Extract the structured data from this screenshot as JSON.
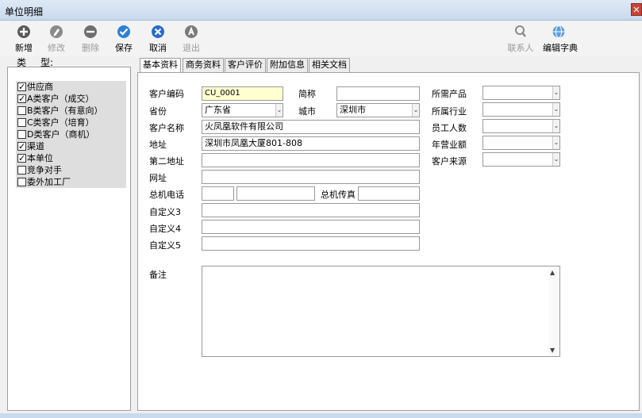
{
  "window": {
    "title": "单位明细",
    "close_glyph": "✕"
  },
  "toolbar": {
    "new": "新增",
    "edit": "修改",
    "delete": "删除",
    "save": "保存",
    "cancel": "取消",
    "exit": "退出",
    "contacts": "联系人",
    "edit_dict": "编辑字典"
  },
  "left": {
    "header_a": "类",
    "header_b": "型:",
    "items": [
      {
        "label": "供应商",
        "state": "checked"
      },
      {
        "label": "A类客户（成交）",
        "state": "checked"
      },
      {
        "label": "B类客户（有意向）",
        "state": "unchecked"
      },
      {
        "label": "C类客户（培育）",
        "state": "unchecked"
      },
      {
        "label": "D类客户（商机）",
        "state": "unchecked"
      },
      {
        "label": "渠道",
        "state": "checked"
      },
      {
        "label": "本单位",
        "state": "checked"
      },
      {
        "label": "竞争对手",
        "state": "unchecked"
      },
      {
        "label": "委外加工厂",
        "state": "unchecked"
      }
    ]
  },
  "tabs": [
    "基本资料",
    "商务资料",
    "客户评价",
    "附加信息",
    "相关文档"
  ],
  "form": {
    "customer_code_label": "客户编码",
    "customer_code": "CU_0001",
    "short_name_label": "简称",
    "short_name": "",
    "required_product_label": "所需产品",
    "province_label": "省份",
    "province": "广东省",
    "city_label": "城市",
    "city": "深圳市",
    "industry_label": "所属行业",
    "customer_name_label": "客户名称",
    "customer_name": "火凤凰软件有限公司",
    "employees_label": "员工人数",
    "address_label": "地址",
    "address": "深圳市凤凰大厦801-808",
    "annual_revenue_label": "年营业额",
    "address2_label": "第二地址",
    "address2": "",
    "customer_source_label": "客户来源",
    "website_label": "网址",
    "website": "",
    "phone_label": "总机电话",
    "fax_label": "总机传真",
    "custom3_label": "自定义3",
    "custom4_label": "自定义4",
    "custom5_label": "自定义5",
    "remarks_label": "备注"
  },
  "colors": {
    "save_icon": "#2f7fd6",
    "cancel_icon": "#2a6cc4",
    "titlebar": "#c9d9ee",
    "code_field": "#ffffd0"
  }
}
